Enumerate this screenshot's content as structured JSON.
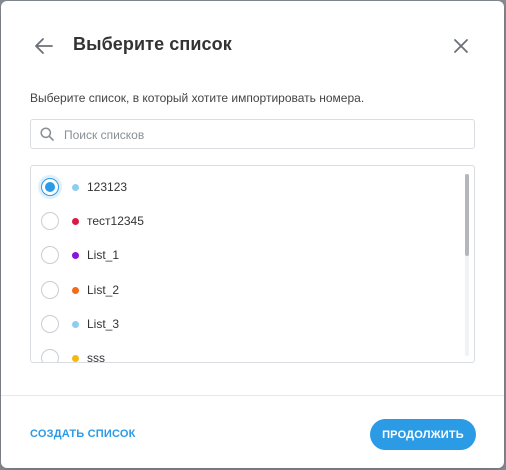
{
  "dialog": {
    "title": "Выберите список",
    "description": "Выберите список, в который хотите импортировать номера.",
    "back_icon": "arrow-left-icon",
    "close_icon": "close-icon"
  },
  "search": {
    "placeholder": "Поиск списков",
    "value": "",
    "icon": "search-icon"
  },
  "lists": [
    {
      "label": "123123",
      "color": "#8ecdf2",
      "selected": true
    },
    {
      "label": "тест12345",
      "color": "#d81b46",
      "selected": false
    },
    {
      "label": "List_1",
      "color": "#8a15d6",
      "selected": false
    },
    {
      "label": "List_2",
      "color": "#f56a17",
      "selected": false
    },
    {
      "label": "List_3",
      "color": "#8ecdf2",
      "selected": false
    },
    {
      "label": "sss",
      "color": "#f5b80f",
      "selected": false
    }
  ],
  "footer": {
    "create_label": "СОЗДАТЬ СПИСОК",
    "continue_label": "ПРОДОЛЖИТЬ"
  },
  "colors": {
    "accent": "#2b9be6"
  }
}
